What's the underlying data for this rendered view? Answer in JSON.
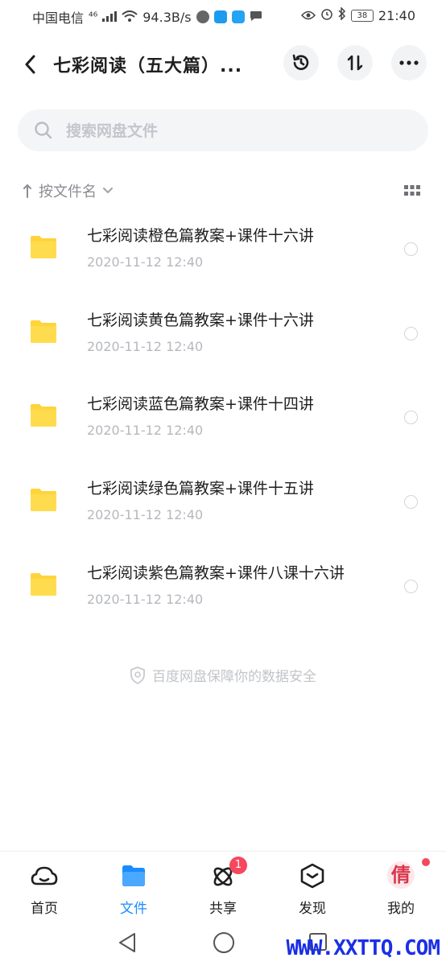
{
  "status_bar": {
    "carrier": "中国电信",
    "network": "⁴⁶",
    "speed": "94.3B/s",
    "battery": "38",
    "time": "21:40"
  },
  "header": {
    "title": "七彩阅读（五大篇）..."
  },
  "search": {
    "placeholder": "搜索网盘文件"
  },
  "sort": {
    "label": "按文件名"
  },
  "files": [
    {
      "name": "七彩阅读橙色篇教案+课件十六讲",
      "date": "2020-11-12  12:40"
    },
    {
      "name": "七彩阅读黄色篇教案+课件十六讲",
      "date": "2020-11-12  12:40"
    },
    {
      "name": "七彩阅读蓝色篇教案+课件十四讲",
      "date": "2020-11-12  12:40"
    },
    {
      "name": "七彩阅读绿色篇教案+课件十五讲",
      "date": "2020-11-12  12:40"
    },
    {
      "name": "七彩阅读紫色篇教案+课件八课十六讲",
      "date": "2020-11-12  12:40"
    }
  ],
  "safe_note": "百度网盘保障你的数据安全",
  "bottom_nav": {
    "home": "首页",
    "files": "文件",
    "share": "共享",
    "share_badge": "1",
    "discover": "发现",
    "mine": "我的"
  },
  "avatar_char": "倩",
  "watermark": "WWW.XXTTQ.COM",
  "colors": {
    "accent": "#1a8cff",
    "folder": "#ffd43b",
    "badge": "#f5475d"
  }
}
